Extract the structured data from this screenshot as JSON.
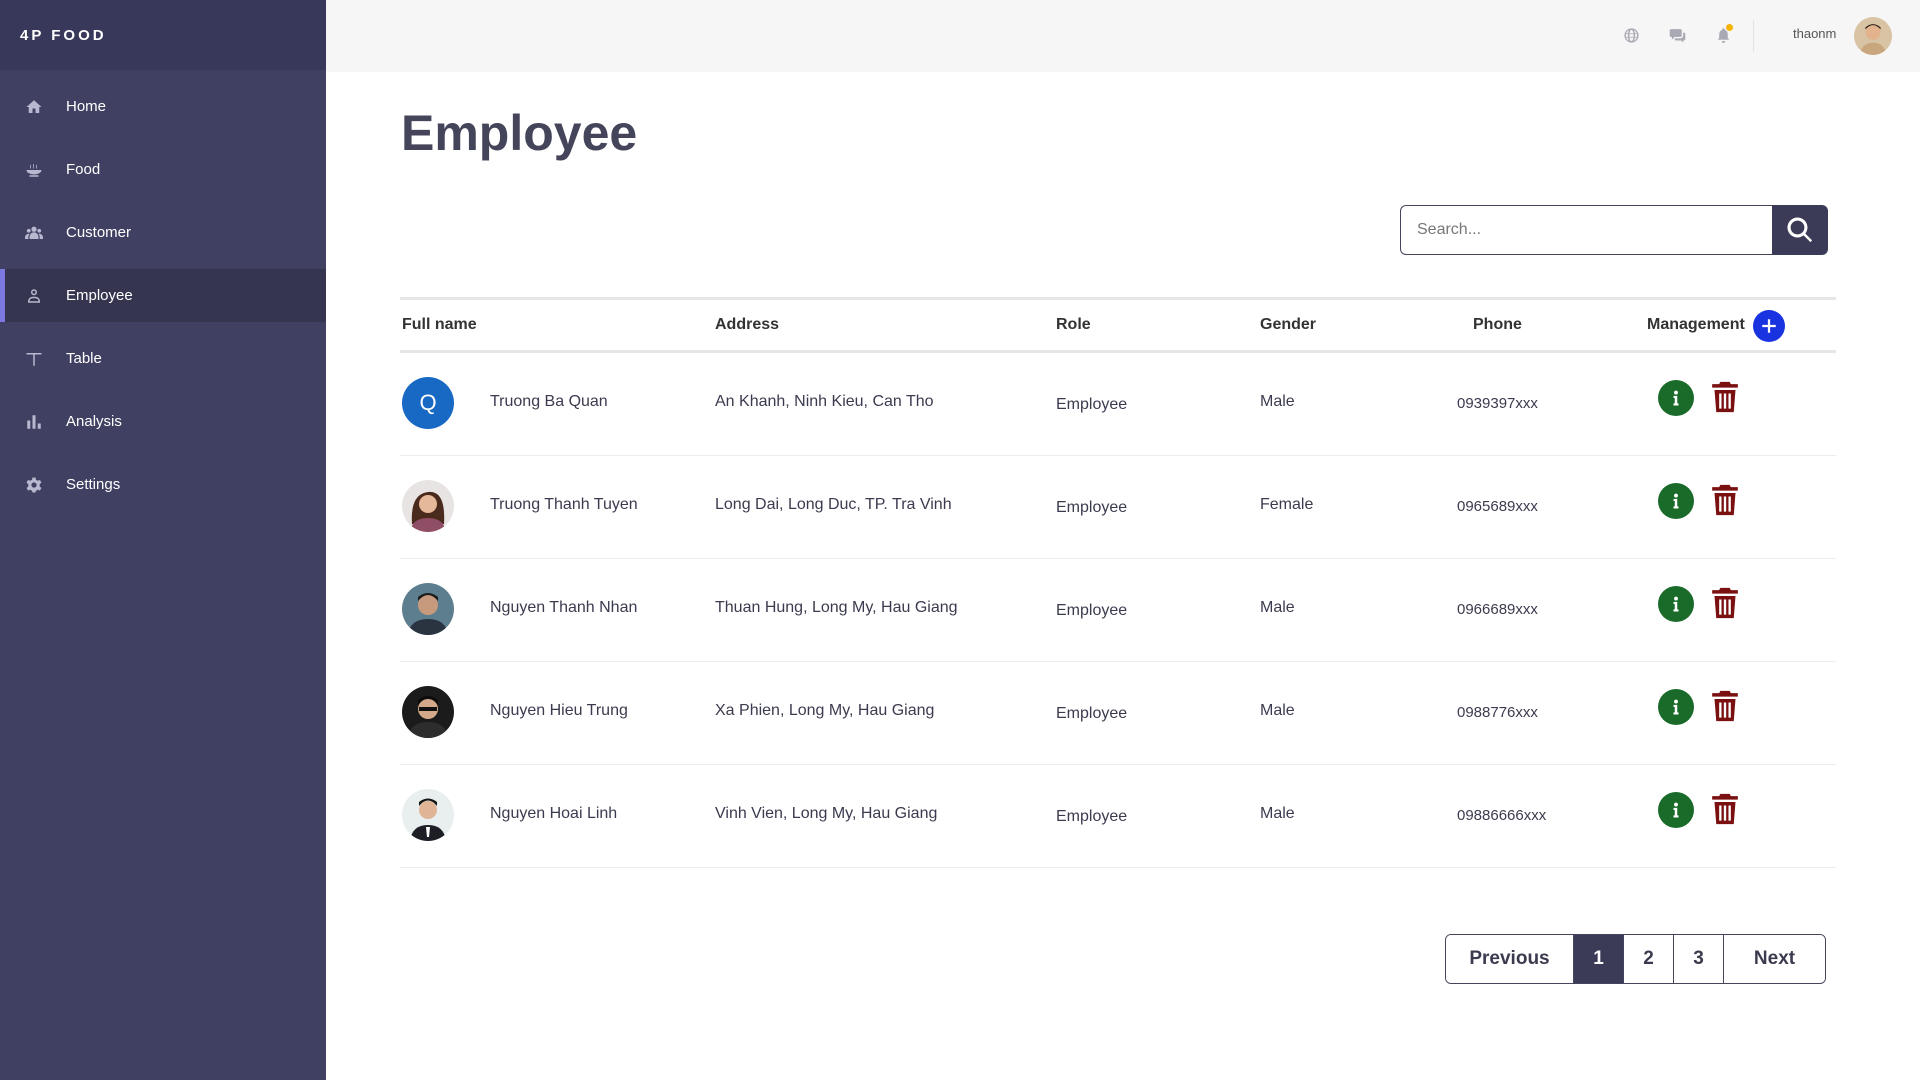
{
  "brand": "4P FOOD",
  "sidebar": {
    "items": [
      {
        "label": "Home",
        "icon": "home-icon"
      },
      {
        "label": "Food",
        "icon": "bowl-icon"
      },
      {
        "label": "Customer",
        "icon": "users-icon"
      },
      {
        "label": "Employee",
        "icon": "user-icon",
        "active": true
      },
      {
        "label": "Table",
        "icon": "table-icon"
      },
      {
        "label": "Analysis",
        "icon": "bar-chart-icon"
      },
      {
        "label": "Settings",
        "icon": "gear-icon"
      }
    ]
  },
  "topbar": {
    "icons": [
      "globe-icon",
      "chat-icon",
      "bell-icon"
    ],
    "username": "thaonm"
  },
  "page_title": "Employee",
  "search": {
    "placeholder": "Search..."
  },
  "table": {
    "headers": {
      "fullname": "Full name",
      "address": "Address",
      "role": "Role",
      "gender": "Gender",
      "phone": "Phone",
      "management": "Management"
    },
    "rows": [
      {
        "avatar": "Q",
        "name": "Truong Ba Quan",
        "address": "An Khanh, Ninh Kieu, Can Tho",
        "role": "Employee",
        "gender": "Male",
        "phone": "0939397xxx"
      },
      {
        "avatar": "photo-woman",
        "name": "Truong Thanh Tuyen",
        "address": "Long Dai, Long Duc, TP. Tra Vinh",
        "role": "Employee",
        "gender": "Female",
        "phone": "0965689xxx"
      },
      {
        "avatar": "photo-man-1",
        "name": "Nguyen Thanh Nhan",
        "address": "Thuan Hung, Long My, Hau Giang",
        "role": "Employee",
        "gender": "Male",
        "phone": "0966689xxx"
      },
      {
        "avatar": "photo-man-2",
        "name": "Nguyen Hieu Trung",
        "address": "Xa Phien, Long My, Hau Giang",
        "role": "Employee",
        "gender": "Male",
        "phone": "0988776xxx"
      },
      {
        "avatar": "photo-man-3",
        "name": "Nguyen Hoai Linh",
        "address": "Vinh Vien, Long My, Hau Giang",
        "role": "Employee",
        "gender": "Male",
        "phone": "09886666xxx"
      }
    ]
  },
  "pagination": {
    "previous": "Previous",
    "pages": [
      "1",
      "2",
      "3"
    ],
    "current": "1",
    "next": "Next"
  },
  "colors": {
    "sidebar": "#404062",
    "accent": "#3b3b58",
    "add": "#1a33e0",
    "info": "#1a6b2a",
    "delete": "#7a1010"
  }
}
